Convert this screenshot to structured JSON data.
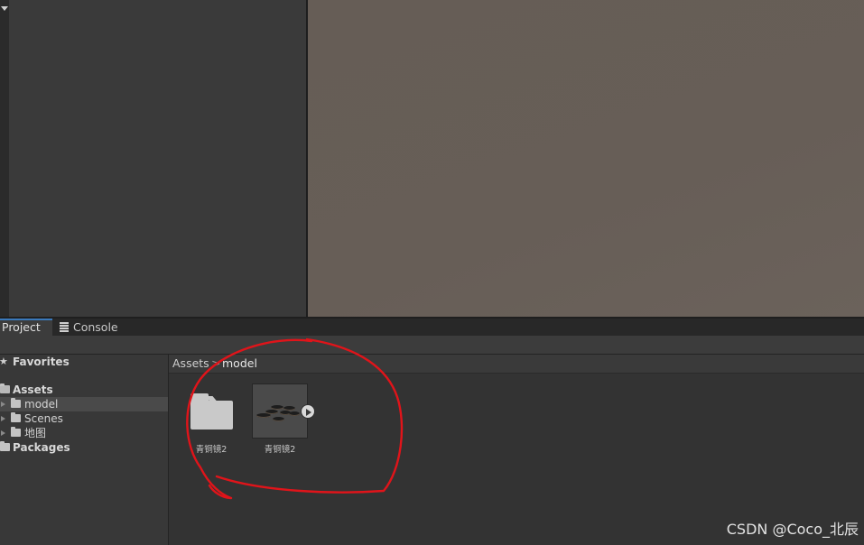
{
  "tabs": [
    {
      "label": "Project",
      "icon": "project-icon",
      "active": true
    },
    {
      "label": "Console",
      "icon": "console-icon",
      "active": false
    }
  ],
  "sidebar": {
    "favorites": "Favorites",
    "assets": "Assets",
    "children": [
      "model",
      "Scenes",
      "地图"
    ],
    "packages": "Packages",
    "selected": "model"
  },
  "breadcrumb": {
    "root": "Assets",
    "separator": ">",
    "current": "model"
  },
  "assets": [
    {
      "name": "青铜镜2",
      "kind": "folder"
    },
    {
      "name": "青铜镜2",
      "kind": "model"
    }
  ],
  "colors": {
    "accent": "#3a79bb",
    "scene_view": "#665d56",
    "annotation": "#e0141a"
  },
  "watermark": "CSDN @Coco_北辰"
}
